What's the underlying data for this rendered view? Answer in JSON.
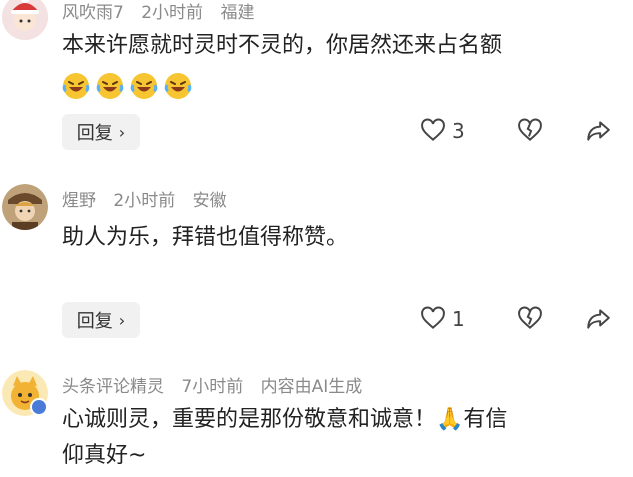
{
  "comments": [
    {
      "username": "风吹雨7",
      "time": "2小时前",
      "location": "福建",
      "text": "本来许愿就时灵时不灵的，你居然还来占名额",
      "emojis": [
        "laughing-crying-emoji",
        "laughing-crying-emoji",
        "laughing-crying-emoji",
        "laughing-crying-emoji"
      ],
      "reply_label": "回复",
      "like_count": "3"
    },
    {
      "username": "煋野",
      "time": "2小时前",
      "location": "安徽",
      "text": "助人为乐，拜错也值得称赞。",
      "reply_label": "回复",
      "like_count": "1"
    },
    {
      "username": "头条评论精灵",
      "time": "7小时前",
      "note": "内容由AI生成",
      "text_line1": "心诚则灵，重要的是那份敬意和诚意！",
      "prayer_emoji": "🙏",
      "text_line1_tail": "有信",
      "text_line2": "仰真好~"
    }
  ],
  "icons": {
    "like": "heart-icon",
    "dislike": "broken-heart-icon",
    "share": "share-arrow-icon"
  },
  "colors": {
    "meta_text": "#8a8a8a",
    "body_text": "#222222",
    "reply_bg": "#f1f1f1",
    "verified_badge": "#4a7bd8"
  }
}
